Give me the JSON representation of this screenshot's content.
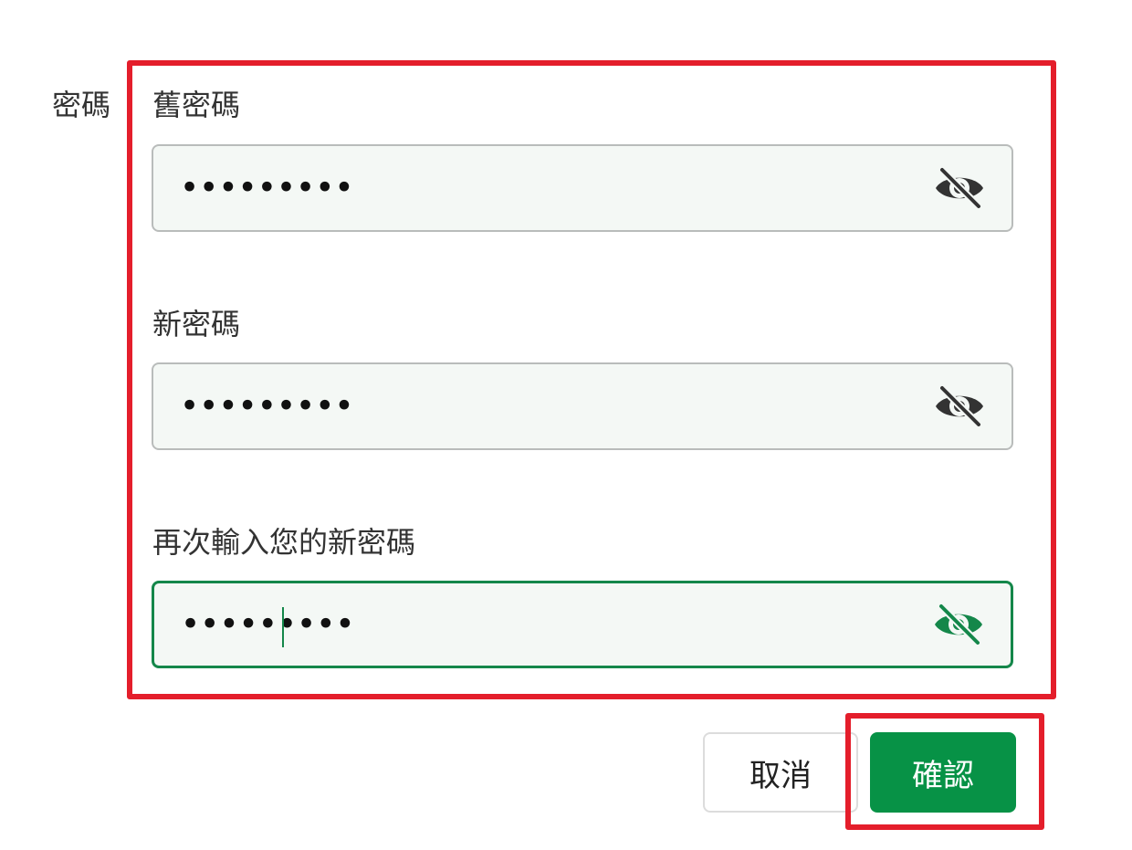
{
  "section": {
    "label": "密碼"
  },
  "fields": [
    {
      "label": "舊密碼",
      "value": "•••••••••",
      "eye_icon": "eye-slash-icon",
      "focused": false
    },
    {
      "label": "新密碼",
      "value": "•••••••••",
      "eye_icon": "eye-slash-icon",
      "focused": false
    },
    {
      "label": "再次輸入您的新密碼",
      "value": "•••••••••",
      "eye_icon": "eye-slash-icon",
      "focused": true
    }
  ],
  "buttons": {
    "cancel_label": "取消",
    "confirm_label": "確認"
  },
  "colors": {
    "accent": "#079246",
    "focus_border": "#14874a",
    "highlight": "#e41e2b",
    "field_background": "#f4f8f5",
    "icon_default": "#333333"
  }
}
